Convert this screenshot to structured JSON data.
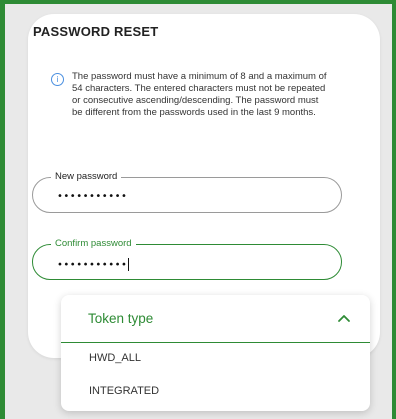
{
  "dialog": {
    "title": "PASSWORD RESET",
    "info_text": "The password must have a minimum of 8 and a maximum of 54 characters. The entered characters must not be repeated or consecutive ascending/descending. The password must be different from the passwords used in the last 9 months.",
    "info_icon": "info-icon"
  },
  "fields": {
    "new_password": {
      "label": "New password",
      "value": "•••••••••••"
    },
    "confirm_password": {
      "label": "Confirm password",
      "value": "•••••••••••"
    }
  },
  "token_type": {
    "label": "Token type",
    "expanded": true,
    "chevron_icon": "chevron-up-icon",
    "options": [
      "HWD_ALL",
      "INTEGRATED"
    ]
  },
  "colors": {
    "accent": "#2e8b35",
    "info": "#4a8fe0"
  }
}
